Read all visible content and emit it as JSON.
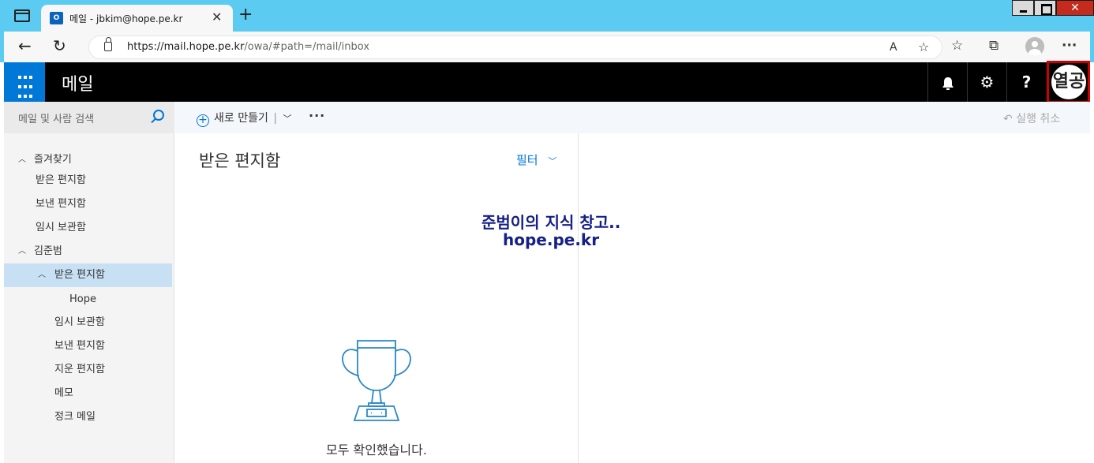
{
  "browser": {
    "tab_title": "메일 - jbkim@hope.pe.kr",
    "tab_favicon": "O",
    "url_host": "https://mail.hope.pe.kr",
    "url_path": "/owa/#path=/mail/inbox"
  },
  "header": {
    "app_title": "메일",
    "avatar_text": "열공"
  },
  "search": {
    "placeholder": "메일 및 사람 검색"
  },
  "sidebar": {
    "favorites_label": "즐겨찾기",
    "favorites": [
      "받은 편지함",
      "보낸 편지함",
      "임시 보관함"
    ],
    "account_label": "김준범",
    "inbox_label": "받은 편지함",
    "inbox_subfolder": "Hope",
    "folders": [
      "임시 보관함",
      "보낸 편지함",
      "지운 편지함",
      "메모",
      "정크 메일"
    ]
  },
  "toolbar": {
    "new_label": "새로 만들기",
    "undo_label": "실행 취소"
  },
  "list": {
    "title": "받은 편지함",
    "filter_label": "필터",
    "empty_message": "모두 확인했습니다."
  },
  "watermark": {
    "line1": "준범이의 지식 창고..",
    "line2": "hope.pe.kr"
  }
}
